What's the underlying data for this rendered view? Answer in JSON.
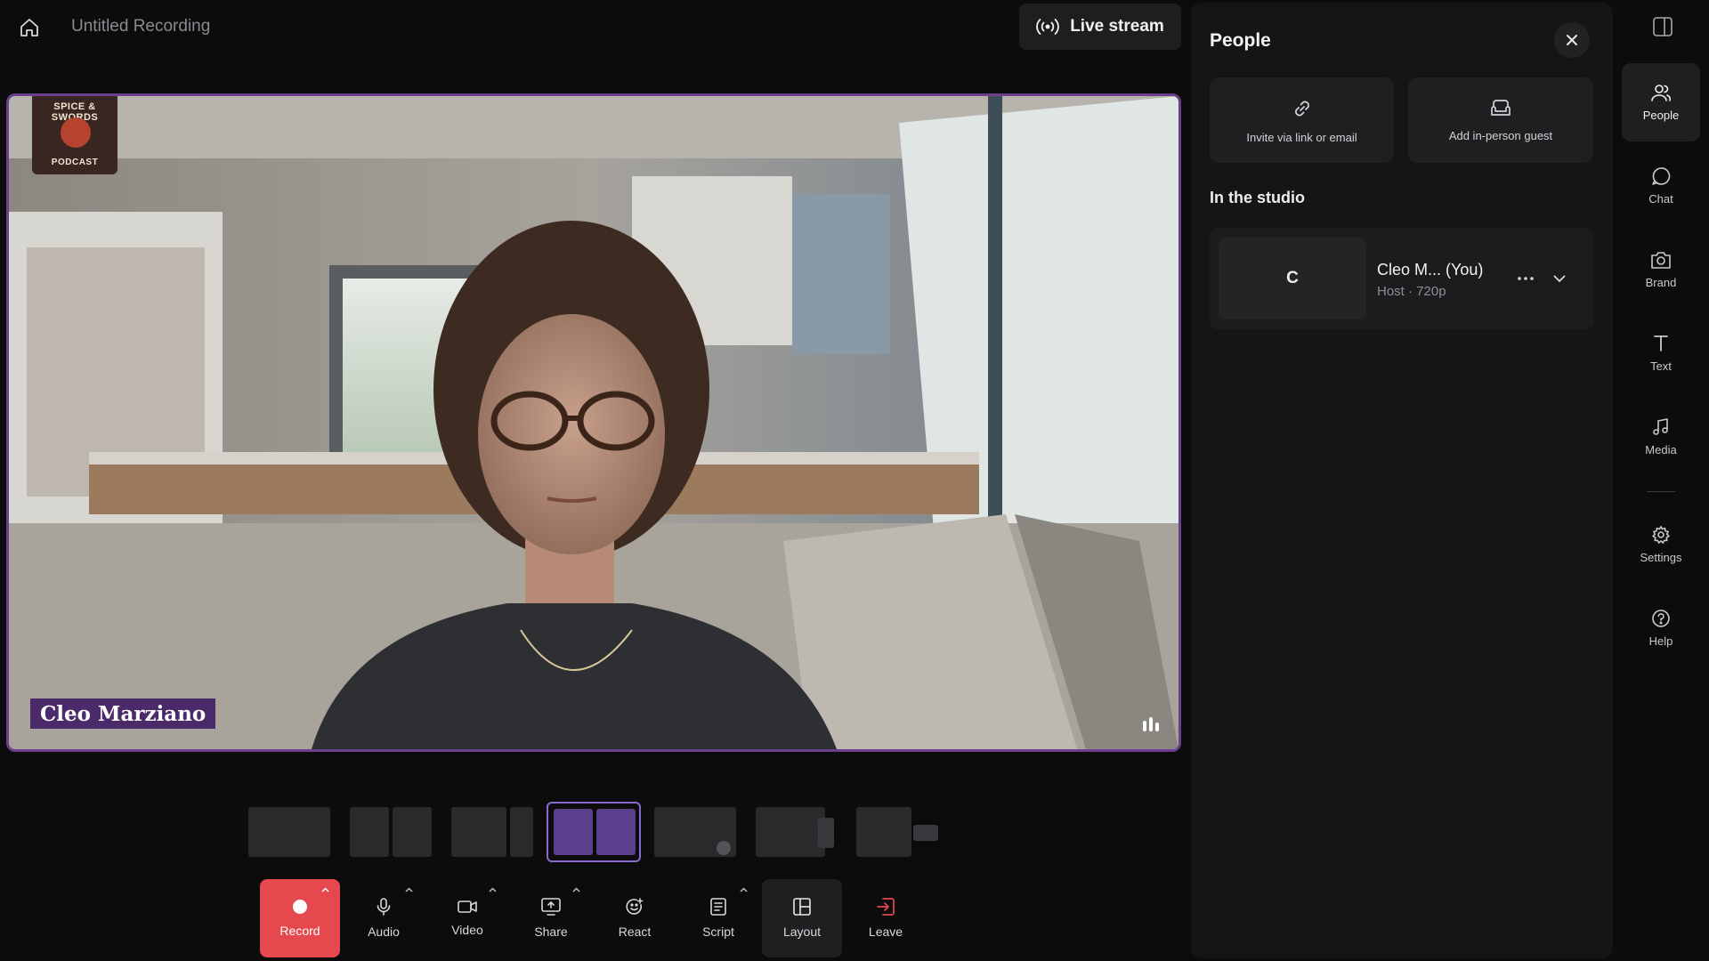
{
  "header": {
    "title": "Untitled Recording",
    "live_stream_label": "Live stream"
  },
  "stage": {
    "speaker_name": "Cleo Marziano",
    "logo_top": "SPICE & SWORDS",
    "logo_bottom": "PODCAST"
  },
  "toolbar": {
    "items": [
      {
        "label": "Record",
        "icon": "record-icon"
      },
      {
        "label": "Audio",
        "icon": "microphone-icon"
      },
      {
        "label": "Video",
        "icon": "camera-icon"
      },
      {
        "label": "Share",
        "icon": "share-screen-icon"
      },
      {
        "label": "React",
        "icon": "emoji-icon"
      },
      {
        "label": "Script",
        "icon": "script-icon"
      },
      {
        "label": "Layout",
        "icon": "layout-icon"
      },
      {
        "label": "Leave",
        "icon": "leave-icon"
      }
    ]
  },
  "people_panel": {
    "title": "People",
    "invite_label": "Invite via link or email",
    "add_guest_label": "Add in-person guest",
    "section_title": "In the studio",
    "participant": {
      "initial": "C",
      "name": "Cleo M...  (You)",
      "meta": "Host · 720p"
    }
  },
  "rail": {
    "items": [
      {
        "label": "People",
        "icon": "people-icon"
      },
      {
        "label": "Chat",
        "icon": "chat-icon"
      },
      {
        "label": "Brand",
        "icon": "brand-icon"
      },
      {
        "label": "Text",
        "icon": "text-icon"
      },
      {
        "label": "Media",
        "icon": "music-note-icon"
      },
      {
        "label": "Settings",
        "icon": "gear-icon"
      },
      {
        "label": "Help",
        "icon": "help-icon"
      }
    ]
  },
  "colors": {
    "accent": "#6b3f8e",
    "record": "#e5484d",
    "name_tag": "#4b2a6a"
  }
}
